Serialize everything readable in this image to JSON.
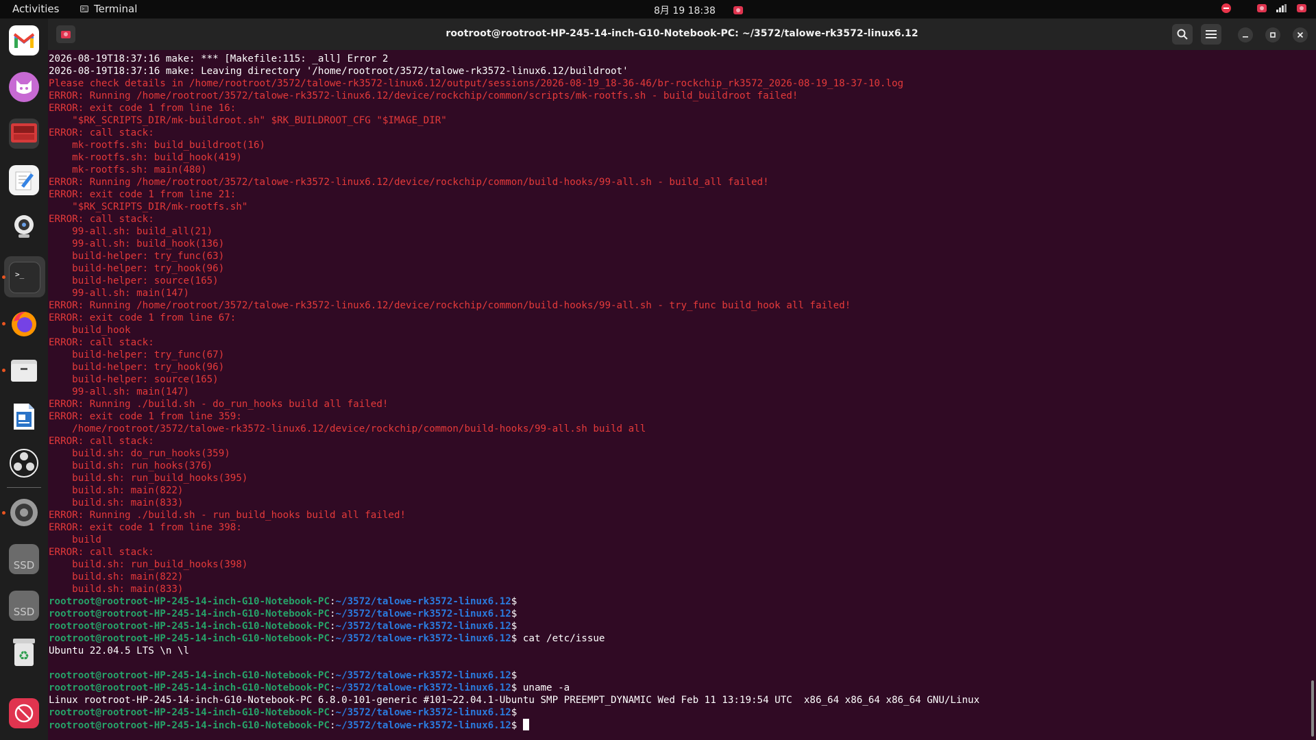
{
  "topbar": {
    "activities": "Activities",
    "app_name": "Terminal",
    "clock": "8月 19  18:38"
  },
  "dock": {
    "items": [
      {
        "name": "gmail",
        "icon": "gmail-icon"
      },
      {
        "name": "cat-app",
        "icon": "cat-icon"
      },
      {
        "name": "screen-recorder",
        "icon": "screen-recorder-icon"
      },
      {
        "name": "text-editor",
        "icon": "text-editor-icon"
      },
      {
        "name": "webcam",
        "icon": "webcam-icon"
      },
      {
        "name": "terminal",
        "icon": "terminal-icon"
      },
      {
        "name": "firefox",
        "icon": "firefox-icon"
      },
      {
        "name": "files",
        "icon": "files-icon"
      },
      {
        "name": "writer",
        "icon": "writer-icon"
      },
      {
        "name": "obs",
        "icon": "obs-icon"
      },
      {
        "name": "settings",
        "icon": "settings-icon"
      },
      {
        "name": "ssd-1",
        "icon": "ssd-drive-icon",
        "label": "SSD"
      },
      {
        "name": "ssd-2",
        "icon": "ssd-drive-icon",
        "label": "SSD"
      },
      {
        "name": "trash",
        "icon": "trash-icon"
      },
      {
        "name": "app-store",
        "icon": "blocked-app-icon"
      }
    ]
  },
  "window": {
    "title": "rootroot@rootroot-HP-245-14-inch-G10-Notebook-PC: ~/3572/talowe-rk3572-linux6.12"
  },
  "terminal": {
    "prompt_user": "rootroot@rootroot-HP-245-14-inch-G10-Notebook-PC",
    "prompt_path": "~/3572/talowe-rk3572-linux6.12",
    "lines": [
      {
        "type": "out",
        "text": "2026-08-19T18:37:16 make: *** [Makefile:115: _all] Error 2"
      },
      {
        "type": "out",
        "text": "2026-08-19T18:37:16 make: Leaving directory '/home/rootroot/3572/talowe-rk3572-linux6.12/buildroot'"
      },
      {
        "type": "err",
        "text": "Please check details in /home/rootroot/3572/talowe-rk3572-linux6.12/output/sessions/2026-08-19_18-36-46/br-rockchip_rk3572_2026-08-19_18-37-10.log"
      },
      {
        "type": "err",
        "text": "ERROR: Running /home/rootroot/3572/talowe-rk3572-linux6.12/device/rockchip/common/scripts/mk-rootfs.sh - build_buildroot failed!"
      },
      {
        "type": "err",
        "text": "ERROR: exit code 1 from line 16:"
      },
      {
        "type": "err",
        "text": "    \"$RK_SCRIPTS_DIR/mk-buildroot.sh\" $RK_BUILDROOT_CFG \"$IMAGE_DIR\""
      },
      {
        "type": "err",
        "text": "ERROR: call stack:"
      },
      {
        "type": "err",
        "text": "    mk-rootfs.sh: build_buildroot(16)"
      },
      {
        "type": "err",
        "text": "    mk-rootfs.sh: build_hook(419)"
      },
      {
        "type": "err",
        "text": "    mk-rootfs.sh: main(480)"
      },
      {
        "type": "err",
        "text": "ERROR: Running /home/rootroot/3572/talowe-rk3572-linux6.12/device/rockchip/common/build-hooks/99-all.sh - build_all failed!"
      },
      {
        "type": "err",
        "text": "ERROR: exit code 1 from line 21:"
      },
      {
        "type": "err",
        "text": "    \"$RK_SCRIPTS_DIR/mk-rootfs.sh\""
      },
      {
        "type": "err",
        "text": "ERROR: call stack:"
      },
      {
        "type": "err",
        "text": "    99-all.sh: build_all(21)"
      },
      {
        "type": "err",
        "text": "    99-all.sh: build_hook(136)"
      },
      {
        "type": "err",
        "text": "    build-helper: try_func(63)"
      },
      {
        "type": "err",
        "text": "    build-helper: try_hook(96)"
      },
      {
        "type": "err",
        "text": "    build-helper: source(165)"
      },
      {
        "type": "err",
        "text": "    99-all.sh: main(147)"
      },
      {
        "type": "err",
        "text": "ERROR: Running /home/rootroot/3572/talowe-rk3572-linux6.12/device/rockchip/common/build-hooks/99-all.sh - try_func build_hook all failed!"
      },
      {
        "type": "err",
        "text": "ERROR: exit code 1 from line 67:"
      },
      {
        "type": "err",
        "text": "    build_hook"
      },
      {
        "type": "err",
        "text": "ERROR: call stack:"
      },
      {
        "type": "err",
        "text": "    build-helper: try_func(67)"
      },
      {
        "type": "err",
        "text": "    build-helper: try_hook(96)"
      },
      {
        "type": "err",
        "text": "    build-helper: source(165)"
      },
      {
        "type": "err",
        "text": "    99-all.sh: main(147)"
      },
      {
        "type": "err",
        "text": "ERROR: Running ./build.sh - do_run_hooks build all failed!"
      },
      {
        "type": "err",
        "text": "ERROR: exit code 1 from line 359:"
      },
      {
        "type": "err",
        "text": "    /home/rootroot/3572/talowe-rk3572-linux6.12/device/rockchip/common/build-hooks/99-all.sh build all"
      },
      {
        "type": "err",
        "text": "ERROR: call stack:"
      },
      {
        "type": "err",
        "text": "    build.sh: do_run_hooks(359)"
      },
      {
        "type": "err",
        "text": "    build.sh: run_hooks(376)"
      },
      {
        "type": "err",
        "text": "    build.sh: run_build_hooks(395)"
      },
      {
        "type": "err",
        "text": "    build.sh: main(822)"
      },
      {
        "type": "err",
        "text": "    build.sh: main(833)"
      },
      {
        "type": "err",
        "text": "ERROR: Running ./build.sh - run_build_hooks build all failed!"
      },
      {
        "type": "err",
        "text": "ERROR: exit code 1 from line 398:"
      },
      {
        "type": "err",
        "text": "    build"
      },
      {
        "type": "err",
        "text": "ERROR: call stack:"
      },
      {
        "type": "err",
        "text": "    build.sh: run_build_hooks(398)"
      },
      {
        "type": "err",
        "text": "    build.sh: main(822)"
      },
      {
        "type": "err",
        "text": "    build.sh: main(833)"
      },
      {
        "type": "prompt",
        "text": ""
      },
      {
        "type": "prompt",
        "text": ""
      },
      {
        "type": "prompt",
        "text": ""
      },
      {
        "type": "prompt",
        "text": " cat /etc/issue"
      },
      {
        "type": "out",
        "text": "Ubuntu 22.04.5 LTS \\n \\l"
      },
      {
        "type": "out",
        "text": ""
      },
      {
        "type": "prompt",
        "text": ""
      },
      {
        "type": "prompt",
        "text": " uname -a"
      },
      {
        "type": "out",
        "text": "Linux rootroot-HP-245-14-inch-G10-Notebook-PC 6.8.0-101-generic #101~22.04.1-Ubuntu SMP PREEMPT_DYNAMIC Wed Feb 11 13:19:54 UTC  x86_64 x86_64 x86_64 GNU/Linux"
      },
      {
        "type": "prompt",
        "text": ""
      },
      {
        "type": "prompt",
        "text": " ",
        "cursor": true
      }
    ]
  },
  "colors": {
    "terminal_bg": "#300a24",
    "error_red": "#e53a3a",
    "prompt_green": "#26a269",
    "prompt_blue": "#2a7bde",
    "accent_orange": "#e95420"
  }
}
